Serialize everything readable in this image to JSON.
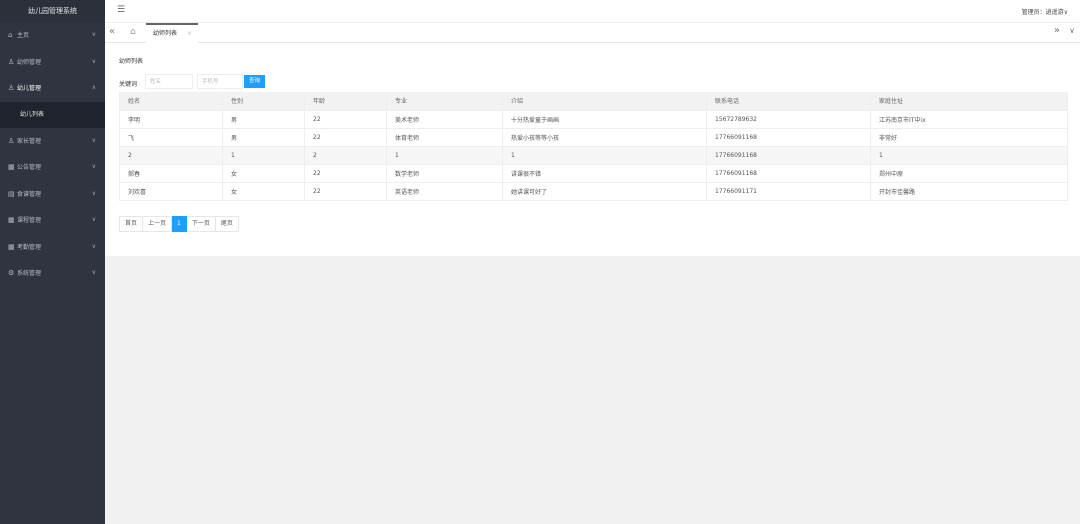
{
  "app": {
    "title": "幼儿园管理系统"
  },
  "sidebar": {
    "items": [
      {
        "icon": "home-icon",
        "glyph": "⌂",
        "label": "主页",
        "open": false
      },
      {
        "icon": "user-icon",
        "glyph": "♙",
        "label": "幼师管理",
        "open": false
      },
      {
        "icon": "child-icon",
        "glyph": "♙",
        "label": "幼儿管理",
        "open": true
      },
      {
        "icon": "parent-icon",
        "glyph": "♙",
        "label": "家长管理",
        "open": false
      },
      {
        "icon": "notice-icon",
        "glyph": "▦",
        "label": "公告管理",
        "open": false
      },
      {
        "icon": "meal-icon",
        "glyph": "▤",
        "label": "食谱管理",
        "open": false
      },
      {
        "icon": "course-icon",
        "glyph": "▦",
        "label": "课程管理",
        "open": false
      },
      {
        "icon": "attendance-icon",
        "glyph": "▦",
        "label": "考勤管理",
        "open": false
      },
      {
        "icon": "settings-icon",
        "glyph": "⚙",
        "label": "系统管理",
        "open": false
      }
    ],
    "submenu": {
      "label": "幼儿列表"
    }
  },
  "topbar": {
    "user": "管理员：逍遥游∨"
  },
  "tabbar": {
    "active_tab": "幼师列表",
    "close": "×",
    "nav_left": "«",
    "nav_right": "»",
    "nav_down": "∨"
  },
  "content": {
    "title": "幼师列表",
    "search": {
      "keyword_label": "关键词",
      "name_placeholder": "姓名",
      "phone_placeholder": "手机号",
      "button": "查询"
    },
    "table": {
      "headers": [
        "姓名",
        "性别",
        "年龄",
        "专业",
        "介绍",
        "联系电话",
        "家庭住址"
      ],
      "rows": [
        [
          "李明",
          "男",
          "22",
          "美术老师",
          "十分热爱童于画画",
          "15672789632",
          "江苏南京市IT中ix"
        ],
        [
          "飞",
          "男",
          "22",
          "体育老师",
          "热爱小孩等等小孩",
          "17766091168",
          "非常好"
        ],
        [
          "2",
          "1",
          "2",
          "1",
          "1",
          "17766091168",
          "1"
        ],
        [
          "郝春",
          "女",
          "22",
          "数学老师",
          "讲课很不错",
          "17766091168",
          "郑州中原"
        ],
        [
          "刘欢喜",
          "女",
          "22",
          "英语老师",
          "她讲课可好了",
          "17766091171",
          "开封市佳馨路"
        ]
      ]
    },
    "pager": {
      "first": "首页",
      "prev": "上一页",
      "current": "1",
      "next": "下一页",
      "last": "尾页"
    }
  }
}
